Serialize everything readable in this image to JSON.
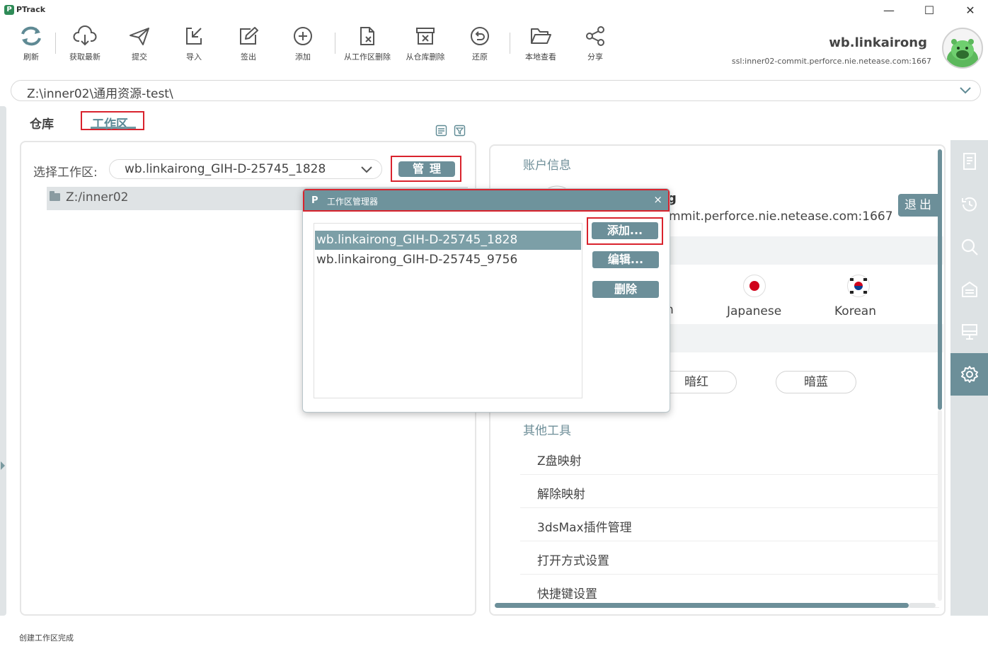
{
  "app": {
    "logo_text": "P",
    "title": "PTrack"
  },
  "window": {
    "minimize": "—",
    "maximize": "☐",
    "close": "✕"
  },
  "toolbar": {
    "items": [
      {
        "label": "刷新",
        "icon": "refresh-icon"
      },
      {
        "label": "获取最新",
        "icon": "cloud-download-icon"
      },
      {
        "label": "提交",
        "icon": "send-icon"
      },
      {
        "label": "导入",
        "icon": "import-icon"
      },
      {
        "label": "签出",
        "icon": "checkout-edit-icon"
      },
      {
        "label": "添加",
        "icon": "plus-circle-icon"
      },
      {
        "label": "从工作区删除",
        "icon": "file-remove-icon"
      },
      {
        "label": "从仓库删除",
        "icon": "box-remove-icon"
      },
      {
        "label": "还原",
        "icon": "revert-icon"
      },
      {
        "label": "本地查看",
        "icon": "folder-open-icon"
      },
      {
        "label": "分享",
        "icon": "share-icon"
      }
    ]
  },
  "user": {
    "name": "wb.linkairong",
    "server": "ssl:inner02-commit.perforce.nie.netease.com:1667"
  },
  "path_bar": {
    "value": "Z:\\inner02\\通用资源-test\\"
  },
  "tabs": {
    "repo": "仓库",
    "workspace": "工作区"
  },
  "left_panel": {
    "select_label": "选择工作区:",
    "selected_workspace": "wb.linkairong_GIH-D-25745_1828",
    "manage_button": "管理",
    "tree_root": "Z:/inner02"
  },
  "right_panel": {
    "account_title": "账户信息",
    "account_name_fragment": "g",
    "account_server_fragment": "mmit.perforce.nie.netease.com:1667",
    "logout_button": "退出",
    "language_fragment": "n",
    "languages": [
      {
        "label": "Japanese",
        "icon": "japan-flag-icon"
      },
      {
        "label": "Korean",
        "icon": "korea-flag-icon"
      }
    ],
    "themes": [
      "暗红",
      "暗蓝"
    ],
    "other_tools_title": "其他工具",
    "tools": [
      "Z盘映射",
      "解除映射",
      "3dsMax插件管理",
      "打开方式设置",
      "快捷键设置"
    ]
  },
  "sidebar": {
    "items": [
      {
        "icon": "document-icon",
        "active": false
      },
      {
        "icon": "history-icon",
        "active": false
      },
      {
        "icon": "search-icon",
        "active": false
      },
      {
        "icon": "shelve-icon",
        "active": false
      },
      {
        "icon": "monitor-icon",
        "active": false
      },
      {
        "icon": "settings-icon",
        "active": true
      }
    ]
  },
  "status": {
    "text": "创建工作区完成"
  },
  "dialog": {
    "title": "工作区管理器",
    "icon_text": "P",
    "close": "×",
    "workspaces": [
      "wb.linkairong_GIH-D-25745_1828",
      "wb.linkairong_GIH-D-25745_9756"
    ],
    "selected_index": 0,
    "add_button": "添加...",
    "edit_button": "编辑...",
    "delete_button": "删除"
  },
  "colors": {
    "accent": "#6c8f99",
    "highlight_border": "#d9232d",
    "selection": "#7c9fa7"
  }
}
